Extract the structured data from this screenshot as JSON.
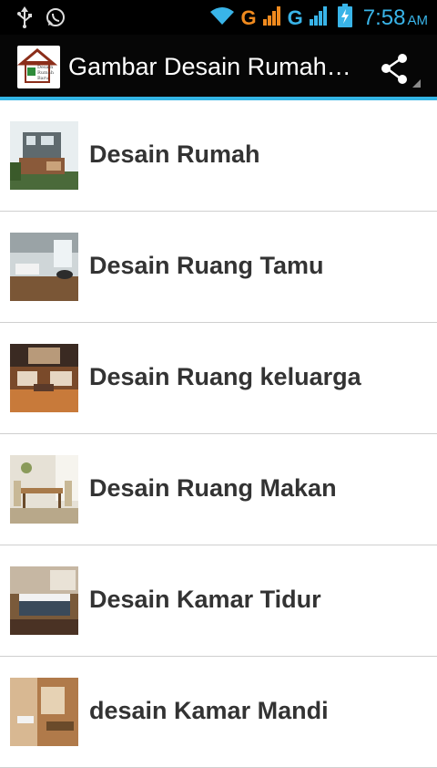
{
  "status_bar": {
    "network_1": "G",
    "network_2": "G",
    "time": "7:58",
    "ampm": "AM",
    "icons": [
      "usb-icon",
      "whatsapp-icon",
      "wifi-icon",
      "signal-icon",
      "signal-icon",
      "battery-charging-icon"
    ]
  },
  "action_bar": {
    "title": "Gambar Desain Rumah…",
    "logo_lines": [
      "Desain",
      "Rumah",
      "Baru"
    ],
    "share_icon": "share-icon",
    "accent_color": "#33b5e5"
  },
  "list": {
    "items": [
      {
        "label": "Desain Rumah",
        "thumb": "house-exterior"
      },
      {
        "label": "Desain Ruang Tamu",
        "thumb": "living-room"
      },
      {
        "label": "Desain Ruang keluarga",
        "thumb": "family-room"
      },
      {
        "label": "Desain Ruang Makan",
        "thumb": "dining-room"
      },
      {
        "label": "Desain Kamar Tidur",
        "thumb": "bedroom"
      },
      {
        "label": "desain Kamar Mandi",
        "thumb": "bathroom"
      }
    ]
  }
}
